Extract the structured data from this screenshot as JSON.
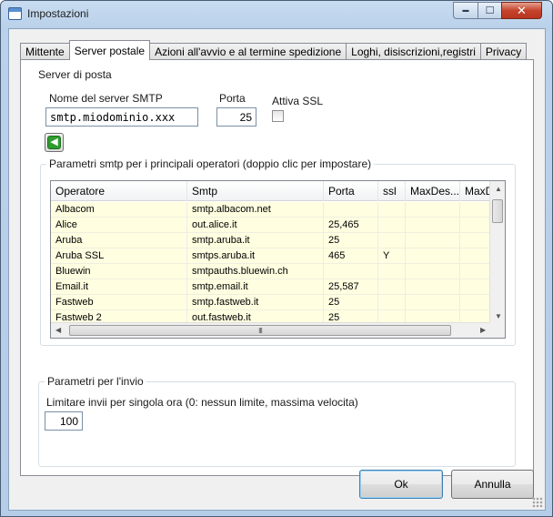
{
  "window": {
    "title": "Impostazioni",
    "icon": "window-icon",
    "caption": {
      "minimize": "▬",
      "maximize": "☐",
      "close": "✕"
    }
  },
  "tabs": [
    {
      "label": "Mittente",
      "active": false
    },
    {
      "label": "Server postale",
      "active": true
    },
    {
      "label": "Azioni all'avvio e al termine spedizione",
      "active": false
    },
    {
      "label": "Loghi, disiscrizioni,registri",
      "active": false
    },
    {
      "label": "Privacy",
      "active": false
    }
  ],
  "server_group": {
    "label": "Server di posta",
    "smtp_label": "Nome del server SMTP",
    "smtp_value": "smtp.miodominio.xxx",
    "port_label": "Porta",
    "port_value": "25",
    "ssl_label": "Attiva SSL",
    "ssl_checked": false
  },
  "operators_group": {
    "label": "Parametri smtp per i principali operatori (doppio clic per impostare)",
    "columns": [
      "Operatore",
      "Smtp",
      "Porta",
      "ssl",
      "MaxDes...",
      "MaxD"
    ],
    "rows": [
      [
        "Albacom",
        "smtp.albacom.net",
        "",
        "",
        "",
        ""
      ],
      [
        "Alice",
        "out.alice.it",
        "25,465",
        "",
        "",
        ""
      ],
      [
        "Aruba",
        "smtp.aruba.it",
        "25",
        "",
        "",
        ""
      ],
      [
        "Aruba SSL",
        "smtps.aruba.it",
        "465",
        "Y",
        "",
        ""
      ],
      [
        "Bluewin",
        "smtpauths.bluewin.ch",
        "",
        "",
        "",
        ""
      ],
      [
        "Email.it",
        "smtp.email.it",
        "25,587",
        "",
        "",
        ""
      ],
      [
        "Fastweb",
        "smtp.fastweb.it",
        "25",
        "",
        "",
        ""
      ],
      [
        "Fastweb 2",
        "out.fastweb.it",
        "25",
        "",
        "",
        ""
      ]
    ],
    "scroll_grip": "III"
  },
  "send_group": {
    "label": "Parametri per l'invio",
    "limit_label": "Limitare invii per singola ora (0: nessun limite, massima velocita)",
    "limit_value": "100"
  },
  "buttons": {
    "ok": "Ok",
    "cancel": "Annulla"
  }
}
